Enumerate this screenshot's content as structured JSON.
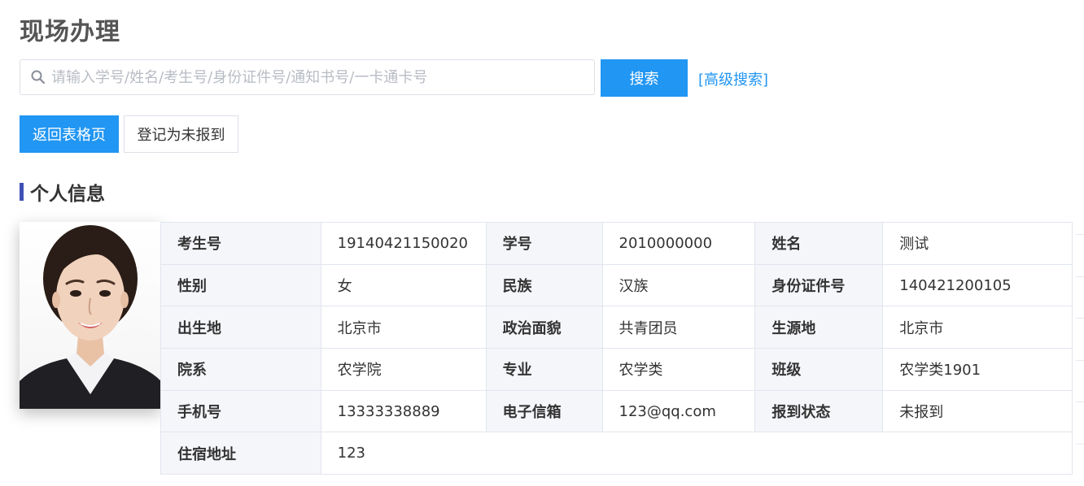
{
  "page": {
    "title": "现场办理"
  },
  "search": {
    "placeholder": "请输入学号/姓名/考生号/身份证件号/通知书号/一卡通卡号",
    "value": "",
    "button_label": "搜索",
    "advanced_label": "[高级搜索]"
  },
  "actions": {
    "back_label": "返回表格页",
    "mark_label": "登记为未报到"
  },
  "section": {
    "title": "个人信息"
  },
  "profile": {
    "rows": [
      [
        {
          "label": "考生号",
          "value": "19140421150020"
        },
        {
          "label": "学号",
          "value": "2010000000"
        },
        {
          "label": "姓名",
          "value": "测试"
        }
      ],
      [
        {
          "label": "性别",
          "value": "女"
        },
        {
          "label": "民族",
          "value": "汉族"
        },
        {
          "label": "身份证件号",
          "value": "140421200105"
        }
      ],
      [
        {
          "label": "出生地",
          "value": "北京市"
        },
        {
          "label": "政治面貌",
          "value": "共青团员"
        },
        {
          "label": "生源地",
          "value": "北京市"
        }
      ],
      [
        {
          "label": "院系",
          "value": "农学院"
        },
        {
          "label": "专业",
          "value": "农学类"
        },
        {
          "label": "班级",
          "value": "农学类1901"
        }
      ],
      [
        {
          "label": "手机号",
          "value": "13333338889"
        },
        {
          "label": "电子信箱",
          "value": "123@qq.com"
        },
        {
          "label": "报到状态",
          "value": "未报到"
        }
      ],
      [
        {
          "label": "住宿地址",
          "value": "123"
        }
      ]
    ]
  },
  "colors": {
    "accent": "#2196f3",
    "section_bar": "#3f51b5",
    "label_bg": "#f5f6fa",
    "border": "#e2e5ee"
  },
  "icons": {
    "search": "search-icon"
  }
}
